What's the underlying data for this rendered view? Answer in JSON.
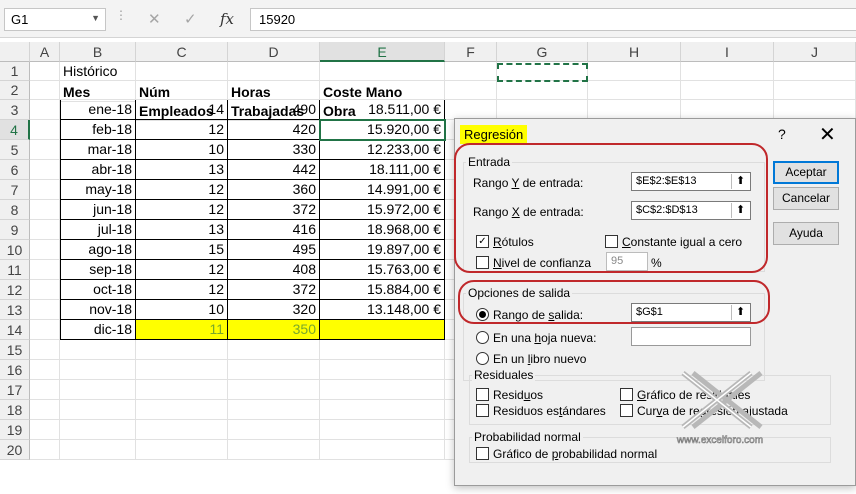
{
  "formula_bar": {
    "name_box": "G1",
    "cancel_icon": "✕",
    "enter_icon": "✓",
    "fx_icon": "fx",
    "value": "15920"
  },
  "sheet": {
    "columns": [
      "A",
      "B",
      "C",
      "D",
      "E",
      "F",
      "G",
      "H",
      "I",
      "J"
    ],
    "selected_column": "E",
    "selected_row": "4",
    "rows": [
      "1",
      "2",
      "3",
      "4",
      "5",
      "6",
      "7",
      "8",
      "9",
      "10",
      "11",
      "12",
      "13",
      "14",
      "15",
      "16",
      "17",
      "18",
      "19",
      "20"
    ],
    "title_cell": "Histórico",
    "headers": {
      "mes": "Mes",
      "num_line1": "Núm",
      "num_line2": "Empleados",
      "horas_line1": "Horas",
      "horas_line2": "Trabajadas",
      "coste_line1": "Coste Mano",
      "coste_line2": "Obra"
    },
    "data_rows": [
      [
        "ene-18",
        "14",
        "490",
        "18.511,00 €"
      ],
      [
        "feb-18",
        "12",
        "420",
        "15.920,00 €"
      ],
      [
        "mar-18",
        "10",
        "330",
        "12.233,00 €"
      ],
      [
        "abr-18",
        "13",
        "442",
        "18.111,00 €"
      ],
      [
        "may-18",
        "12",
        "360",
        "14.991,00 €"
      ],
      [
        "jun-18",
        "12",
        "372",
        "15.972,00 €"
      ],
      [
        "jul-18",
        "13",
        "416",
        "18.968,00 €"
      ],
      [
        "ago-18",
        "15",
        "495",
        "19.897,00 €"
      ],
      [
        "sep-18",
        "12",
        "408",
        "15.763,00 €"
      ],
      [
        "oct-18",
        "12",
        "372",
        "15.884,00 €"
      ],
      [
        "nov-18",
        "10",
        "320",
        "13.148,00 €"
      ],
      [
        "dic-18",
        "11",
        "350",
        ""
      ]
    ]
  },
  "dialog": {
    "title": "Regresión",
    "help_icon": "?",
    "close_icon": "✕",
    "buttons": {
      "ok": "Aceptar",
      "cancel": "Cancelar",
      "help": "Ayuda"
    },
    "entrada": {
      "label": "Entrada",
      "y_range_label": "Rango Y de entrada:",
      "y_range_value": "$E$2:$E$13",
      "x_range_label": "Rango X de entrada:",
      "x_range_value": "$C$2:$D$13",
      "rotulos": "Rótulos",
      "rotulos_checked": true,
      "constante": "Constante igual a cero",
      "nivel": "Nivel de confianza",
      "nivel_value": "95",
      "percent": "%"
    },
    "salida": {
      "label": "Opciones de salida",
      "rango_label": "Rango de salida:",
      "rango_value": "$G$1",
      "hoja_label": "En una hoja nueva:",
      "libro_label": "En un libro nuevo"
    },
    "residuales": {
      "label": "Residuales",
      "residuos": "Residuos",
      "residuos_std": "Residuos estándares",
      "grafico_res": "Gráfico de residuales",
      "curva": "Curva de regresión ajustada"
    },
    "probabilidad": {
      "label": "Probabilidad normal",
      "grafico": "Gráfico de probabilidad normal"
    },
    "collapse_icon": "⬆"
  },
  "watermark": "www.excelforo.com",
  "colors": {
    "excel_green": "#217346",
    "highlight_yellow": "#ffff00",
    "annotation_red": "#c0282b"
  }
}
